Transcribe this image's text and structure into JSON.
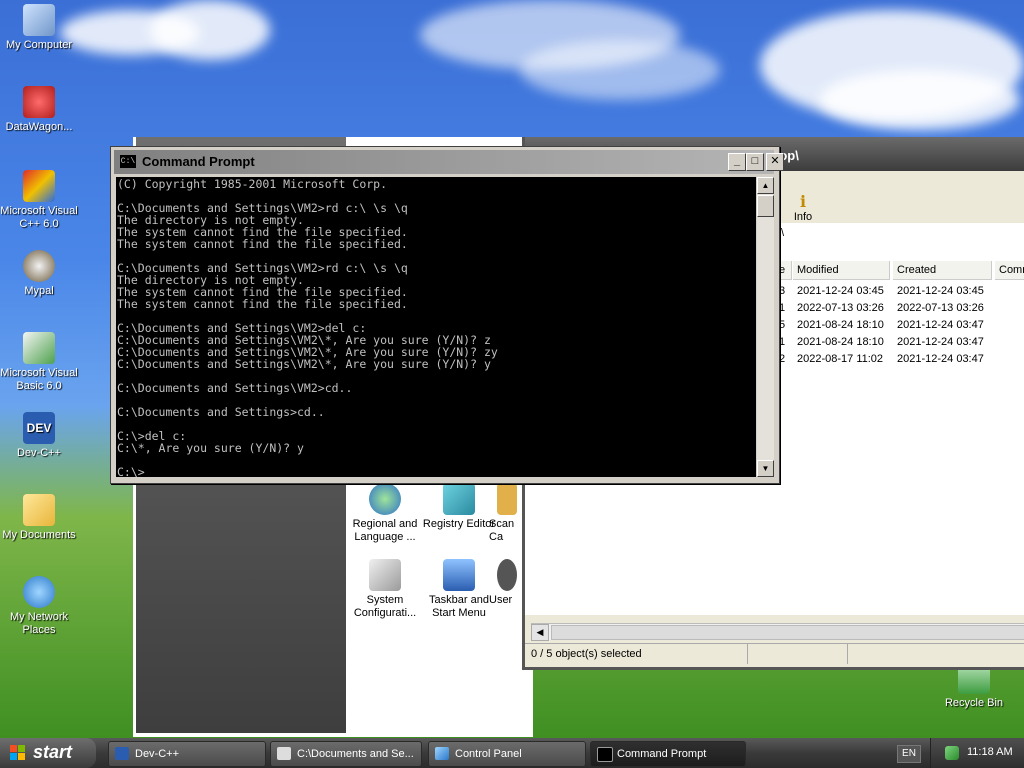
{
  "desktop": {
    "icons": [
      {
        "label": "My Computer"
      },
      {
        "label": "DataWagon..."
      },
      {
        "label": "Microsoft Visual C++ 6.0"
      },
      {
        "label": "Mypal"
      },
      {
        "label": "Microsoft Visual Basic 6.0"
      },
      {
        "label": "Dev-C++"
      },
      {
        "label": "My Documents"
      },
      {
        "label": "My Network Places"
      },
      {
        "label": "Recycle Bin"
      }
    ]
  },
  "control_panel": {
    "items": [
      {
        "label": "Regional and Language ..."
      },
      {
        "label": "Registry Editor"
      },
      {
        "label": "Scan Ca"
      },
      {
        "label": "System Configurati..."
      },
      {
        "label": "Taskbar and Start Menu"
      },
      {
        "label": "User"
      }
    ]
  },
  "explorer": {
    "title_fragment": "top\\",
    "toolbar_info": "Info",
    "address_fragment": "\\",
    "columns": [
      "e",
      "Modified",
      "Created",
      "Comm"
    ],
    "rows": [
      {
        "frag": "3",
        "modified": "2021-12-24 03:45",
        "created": "2021-12-24 03:45"
      },
      {
        "frag": "1",
        "modified": "2022-07-13 03:26",
        "created": "2022-07-13 03:26"
      },
      {
        "frag": "5",
        "modified": "2021-08-24 18:10",
        "created": "2021-12-24 03:47"
      },
      {
        "frag": "1",
        "modified": "2021-08-24 18:10",
        "created": "2021-12-24 03:47"
      },
      {
        "frag": "2",
        "modified": "2022-08-17 11:02",
        "created": "2021-12-24 03:47"
      }
    ],
    "status": "0 / 5 object(s) selected"
  },
  "cmd": {
    "title": "Command Prompt",
    "icon_text": "C:\\",
    "buttons": {
      "minimize": "_",
      "maximize": "□",
      "close": "✕"
    },
    "lines": [
      "(C) Copyright 1985-2001 Microsoft Corp.",
      "",
      "C:\\Documents and Settings\\VM2>rd c:\\ \\s \\q",
      "The directory is not empty.",
      "The system cannot find the file specified.",
      "The system cannot find the file specified.",
      "",
      "C:\\Documents and Settings\\VM2>rd c:\\ \\s \\q",
      "The directory is not empty.",
      "The system cannot find the file specified.",
      "The system cannot find the file specified.",
      "",
      "C:\\Documents and Settings\\VM2>del c:",
      "C:\\Documents and Settings\\VM2\\*, Are you sure (Y/N)? z",
      "C:\\Documents and Settings\\VM2\\*, Are you sure (Y/N)? zy",
      "C:\\Documents and Settings\\VM2\\*, Are you sure (Y/N)? y",
      "",
      "C:\\Documents and Settings\\VM2>cd..",
      "",
      "C:\\Documents and Settings>cd..",
      "",
      "C:\\>del c:",
      "C:\\*, Are you sure (Y/N)? y",
      "",
      "C:\\>"
    ]
  },
  "taskbar": {
    "start_label": "start",
    "tasks": [
      {
        "label": "Dev-C++"
      },
      {
        "label": "C:\\Documents and Se..."
      },
      {
        "label": "Control Panel"
      },
      {
        "label": "Command Prompt"
      }
    ],
    "lang": "EN",
    "clock": "11:18 AM"
  },
  "colors": {
    "console_bg": "#000000",
    "console_fg": "#c0c0c0"
  }
}
